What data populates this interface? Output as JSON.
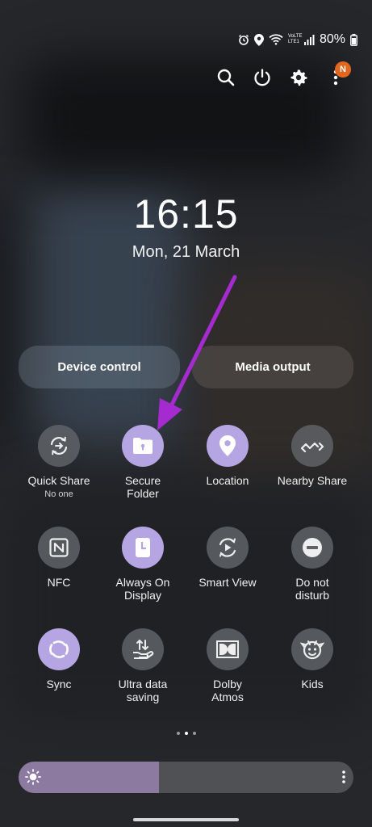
{
  "status_bar": {
    "network": "VoLTE LTE1",
    "battery": "80%"
  },
  "toolbar": {
    "notification_badge": "N"
  },
  "lockscreen": {
    "time": "16:15",
    "date": "Mon, 21 March"
  },
  "pills": {
    "device_control": "Device control",
    "media_output": "Media output"
  },
  "tiles": [
    {
      "label": "Quick Share",
      "sub": "No one",
      "icon": "quick-share-icon",
      "on": false
    },
    {
      "label": "Secure Folder",
      "icon": "secure-folder-icon",
      "on": true
    },
    {
      "label": "Location",
      "icon": "location-pin-icon",
      "on": true
    },
    {
      "label": "Nearby Share",
      "icon": "nearby-share-icon",
      "on": false
    },
    {
      "label": "NFC",
      "icon": "nfc-icon",
      "on": false
    },
    {
      "label": "Always On Display",
      "icon": "always-on-display-icon",
      "on": true
    },
    {
      "label": "Smart View",
      "icon": "smart-view-icon",
      "on": false
    },
    {
      "label": "Do not disturb",
      "icon": "do-not-disturb-icon",
      "on": false
    },
    {
      "label": "Sync",
      "icon": "sync-icon",
      "on": true
    },
    {
      "label": "Ultra data saving",
      "icon": "ultra-data-saving-icon",
      "on": false
    },
    {
      "label": "Dolby Atmos",
      "icon": "dolby-atmos-icon",
      "on": false
    },
    {
      "label": "Kids",
      "icon": "kids-icon",
      "on": false
    }
  ],
  "pager": {
    "pages": 3,
    "active": 2
  },
  "brightness": {
    "level_percent": 42
  },
  "colors": {
    "tile_on": "#b5a5e2",
    "tile_off": "#5f6166",
    "brightness_fill": "#8d7aa0",
    "badge": "#e2661c",
    "annotation_arrow": "#a52bd1"
  }
}
